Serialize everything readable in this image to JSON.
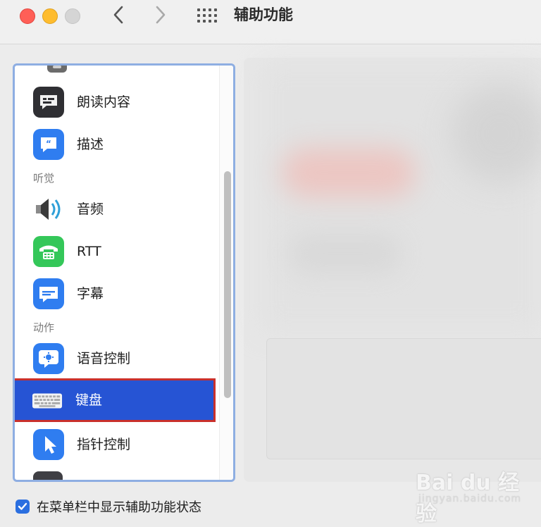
{
  "window": {
    "title": "辅助功能",
    "back_icon": "chevron-left-icon",
    "forward_icon": "chevron-right-icon",
    "grid_icon": "grid-icon"
  },
  "sidebar": {
    "sections": {
      "hearing": "听觉",
      "motor": "动作"
    },
    "items": [
      {
        "label": "朗读内容",
        "icon": "spoken-content-icon"
      },
      {
        "label": "描述",
        "icon": "descriptions-icon"
      },
      {
        "label": "音频",
        "icon": "audio-speaker-icon"
      },
      {
        "label": "RTT",
        "icon": "rtt-phone-icon"
      },
      {
        "label": "字幕",
        "icon": "captions-icon"
      },
      {
        "label": "语音控制",
        "icon": "voice-control-icon"
      },
      {
        "label": "键盘",
        "icon": "keyboard-icon",
        "selected": true
      },
      {
        "label": "指针控制",
        "icon": "pointer-control-icon"
      }
    ]
  },
  "footer": {
    "show_status_label": "在菜单栏中显示辅助功能状态",
    "checked": true
  },
  "watermark": {
    "brand": "Bai du 经验",
    "url": "jingyan.baidu.com"
  },
  "colors": {
    "selection": "#2654d4",
    "highlight_border": "#c9302c",
    "sidebar_focus_ring": "#8eaee2",
    "checkbox": "#2b6fe0"
  }
}
